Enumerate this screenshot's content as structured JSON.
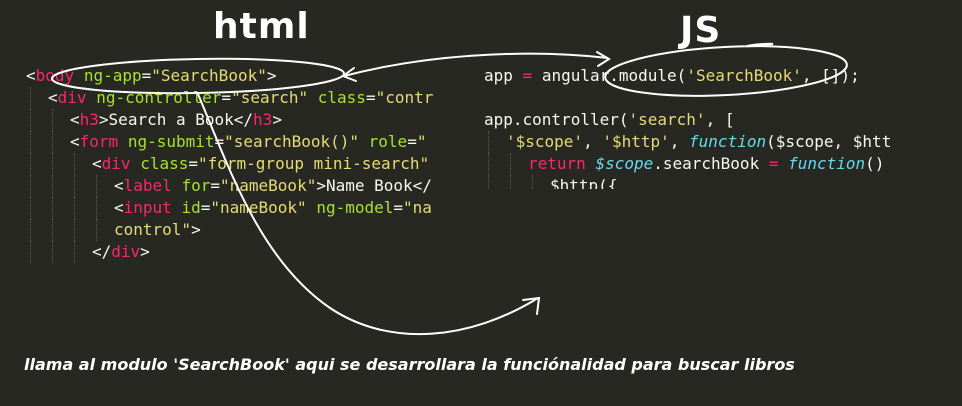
{
  "headings": {
    "html": "html",
    "js": "JS"
  },
  "html_code": {
    "lines": [
      {
        "indent": 0,
        "tokens": [
          {
            "t": "<",
            "c": "punct"
          },
          {
            "t": "body",
            "c": "tag"
          },
          {
            "t": " ",
            "c": "text"
          },
          {
            "t": "ng-app",
            "c": "attr"
          },
          {
            "t": "=",
            "c": "punct"
          },
          {
            "t": "\"SearchBook\"",
            "c": "str"
          },
          {
            "t": ">",
            "c": "punct"
          }
        ]
      },
      {
        "indent": 1,
        "tokens": [
          {
            "t": "<",
            "c": "punct"
          },
          {
            "t": "div",
            "c": "tag"
          },
          {
            "t": " ",
            "c": "text"
          },
          {
            "t": "ng-controller",
            "c": "attr"
          },
          {
            "t": "=",
            "c": "punct"
          },
          {
            "t": "\"search\"",
            "c": "str"
          },
          {
            "t": " ",
            "c": "text"
          },
          {
            "t": "class",
            "c": "attr"
          },
          {
            "t": "=",
            "c": "punct"
          },
          {
            "t": "\"contr",
            "c": "str"
          }
        ]
      },
      {
        "indent": 2,
        "tokens": [
          {
            "t": "<",
            "c": "punct"
          },
          {
            "t": "h3",
            "c": "tag"
          },
          {
            "t": ">",
            "c": "punct"
          },
          {
            "t": "Search a Book",
            "c": "text"
          },
          {
            "t": "</",
            "c": "punct"
          },
          {
            "t": "h3",
            "c": "tag"
          },
          {
            "t": ">",
            "c": "punct"
          }
        ]
      },
      {
        "indent": 2,
        "tokens": [
          {
            "t": "<",
            "c": "punct"
          },
          {
            "t": "form",
            "c": "tag"
          },
          {
            "t": " ",
            "c": "text"
          },
          {
            "t": "ng-submit",
            "c": "attr"
          },
          {
            "t": "=",
            "c": "punct"
          },
          {
            "t": "\"searchBook()\"",
            "c": "str"
          },
          {
            "t": " ",
            "c": "text"
          },
          {
            "t": "role",
            "c": "attr"
          },
          {
            "t": "=",
            "c": "punct"
          },
          {
            "t": "\"",
            "c": "str"
          }
        ]
      },
      {
        "indent": 3,
        "tokens": [
          {
            "t": "<",
            "c": "punct"
          },
          {
            "t": "div",
            "c": "tag"
          },
          {
            "t": " ",
            "c": "text"
          },
          {
            "t": "class",
            "c": "attr"
          },
          {
            "t": "=",
            "c": "punct"
          },
          {
            "t": "\"form-group mini-search\"",
            "c": "str"
          }
        ]
      },
      {
        "indent": 4,
        "tokens": [
          {
            "t": "<",
            "c": "punct"
          },
          {
            "t": "label",
            "c": "tag"
          },
          {
            "t": " ",
            "c": "text"
          },
          {
            "t": "for",
            "c": "attr"
          },
          {
            "t": "=",
            "c": "punct"
          },
          {
            "t": "\"nameBook\"",
            "c": "str"
          },
          {
            "t": ">",
            "c": "punct"
          },
          {
            "t": "Name Book",
            "c": "text"
          },
          {
            "t": "</",
            "c": "punct"
          }
        ]
      },
      {
        "indent": 4,
        "tokens": [
          {
            "t": "<",
            "c": "punct"
          },
          {
            "t": "input",
            "c": "tag"
          },
          {
            "t": " ",
            "c": "text"
          },
          {
            "t": "id",
            "c": "attr"
          },
          {
            "t": "=",
            "c": "punct"
          },
          {
            "t": "\"nameBook\"",
            "c": "str"
          },
          {
            "t": " ",
            "c": "text"
          },
          {
            "t": "ng-model",
            "c": "attr"
          },
          {
            "t": "=",
            "c": "punct"
          },
          {
            "t": "\"na",
            "c": "str"
          }
        ]
      },
      {
        "indent": 4,
        "tokens": [
          {
            "t": "control\"",
            "c": "str"
          },
          {
            "t": ">",
            "c": "punct"
          }
        ]
      },
      {
        "indent": 3,
        "tokens": [
          {
            "t": "</",
            "c": "punct"
          },
          {
            "t": "div",
            "c": "tag"
          },
          {
            "t": ">",
            "c": "punct"
          }
        ]
      }
    ]
  },
  "js_code": {
    "lines": [
      {
        "indent": 0,
        "tokens": [
          {
            "t": "app",
            "c": "ident"
          },
          {
            "t": " ",
            "c": "text"
          },
          {
            "t": "=",
            "c": "kw"
          },
          {
            "t": " angular.module(",
            "c": "ident"
          },
          {
            "t": "'SearchBook'",
            "c": "str"
          },
          {
            "t": ", []);",
            "c": "ident"
          }
        ]
      },
      {
        "indent": 0,
        "tokens": []
      },
      {
        "indent": 0,
        "tokens": [
          {
            "t": "app.controller(",
            "c": "ident"
          },
          {
            "t": "'search'",
            "c": "str"
          },
          {
            "t": ", [",
            "c": "ident"
          }
        ]
      },
      {
        "indent": 1,
        "tokens": [
          {
            "t": "'$scope'",
            "c": "str"
          },
          {
            "t": ", ",
            "c": "ident"
          },
          {
            "t": "'$http'",
            "c": "str"
          },
          {
            "t": ", ",
            "c": "ident"
          },
          {
            "t": "function",
            "c": "fn"
          },
          {
            "t": "($scope, $htt",
            "c": "ident"
          }
        ]
      },
      {
        "indent": 2,
        "tokens": [
          {
            "t": "return",
            "c": "kw"
          },
          {
            "t": " ",
            "c": "text"
          },
          {
            "t": "$scope",
            "c": "fn"
          },
          {
            "t": ".searchBook ",
            "c": "ident"
          },
          {
            "t": "=",
            "c": "kw"
          },
          {
            "t": " ",
            "c": "text"
          },
          {
            "t": "function",
            "c": "fn"
          },
          {
            "t": "()",
            "c": "ident"
          }
        ]
      },
      {
        "indent": 3,
        "tokens": [
          {
            "t": "$http({",
            "c": "ident"
          }
        ]
      }
    ]
  },
  "caption": "llama al modulo 'SearchBook' aqui se desarrollara la funciónalidad para buscar libros",
  "colors": {
    "background": "#272822",
    "tag": "#f92672",
    "attribute": "#a6e22e",
    "string": "#e6db74",
    "function": "#66d9ef",
    "plain": "#f8f8f2",
    "annotation": "#ffffff"
  }
}
